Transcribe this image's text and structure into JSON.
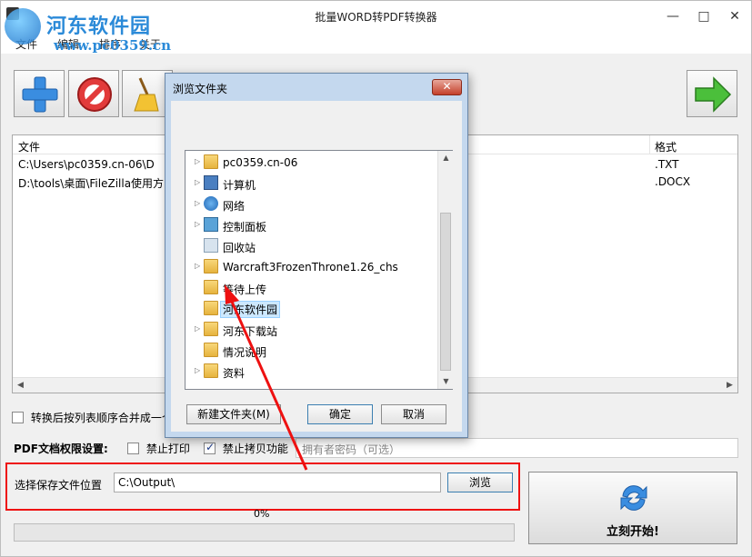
{
  "window": {
    "title": "批量WORD转PDF转换器",
    "min": "—",
    "max": "□",
    "close": "✕"
  },
  "watermark": {
    "name": "河东软件园",
    "url": "www.pc0359.cn"
  },
  "menu": {
    "items": [
      "文件",
      "编辑",
      "排序",
      "关于"
    ]
  },
  "toolbar": {
    "icons": [
      "add-icon",
      "remove-icon",
      "clear-broom-icon",
      "next-arrow-icon"
    ]
  },
  "file_list": {
    "col_file": "文件",
    "col_format": "格式",
    "rows": [
      {
        "path": "C:\\Users\\pc0359.cn-06\\D",
        "format": ".TXT"
      },
      {
        "path": "D:\\tools\\桌面\\FileZilla使用方",
        "format": ".DOCX"
      }
    ]
  },
  "options": {
    "merge_label": "转换后按列表顺序合并成一个",
    "merge_checked": false,
    "perm_title": "PDF文档权限设置:",
    "no_print_label": "禁止打印",
    "no_print_checked": false,
    "no_copy_label": "禁止拷贝功能",
    "no_copy_checked": true,
    "owner_pwd_placeholder": "拥有者密码（可选）"
  },
  "save": {
    "label": "选择保存文件位置",
    "path": "C:\\Output\\",
    "browse": "浏览"
  },
  "progress": {
    "percent_text": "0%",
    "value": 0
  },
  "start": {
    "label": "立刻开始!"
  },
  "dialog": {
    "title": "浏览文件夹",
    "close": "✕",
    "tree": [
      {
        "label": "pc0359.cn-06",
        "icon": "user-folder-icon",
        "expandable": true,
        "selected": false
      },
      {
        "label": "计算机",
        "icon": "computer-icon",
        "expandable": true,
        "selected": false
      },
      {
        "label": "网络",
        "icon": "network-icon",
        "expandable": true,
        "selected": false
      },
      {
        "label": "控制面板",
        "icon": "control-panel-icon",
        "expandable": true,
        "selected": false
      },
      {
        "label": "回收站",
        "icon": "recycle-bin-icon",
        "expandable": false,
        "selected": false
      },
      {
        "label": "Warcraft3FrozenThrone1.26_chs",
        "icon": "folder-icon",
        "expandable": true,
        "selected": false
      },
      {
        "label": "等待上传",
        "icon": "folder-icon",
        "expandable": false,
        "selected": false
      },
      {
        "label": "河东软件园",
        "icon": "folder-icon",
        "expandable": false,
        "selected": true
      },
      {
        "label": "河东下载站",
        "icon": "folder-icon",
        "expandable": true,
        "selected": false
      },
      {
        "label": "情况说明",
        "icon": "folder-icon",
        "expandable": false,
        "selected": false
      },
      {
        "label": "资料",
        "icon": "folder-icon",
        "expandable": true,
        "selected": false
      }
    ],
    "new_folder": "新建文件夹(M)",
    "ok": "确定",
    "cancel": "取消"
  },
  "colors": {
    "accent": "#2b8ad8",
    "highlight_red": "#e11111",
    "selection": "#cce8ff"
  }
}
